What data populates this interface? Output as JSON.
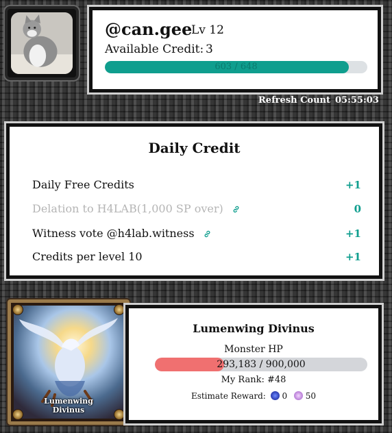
{
  "profile": {
    "username": "@can.gee",
    "level": "Lv 12",
    "credit_label": "Available Credit:",
    "credit_value": "3",
    "progress_text": "603 / 648",
    "progress_value": 603,
    "progress_max": 648
  },
  "refresh": {
    "label": "Refresh Count",
    "time": "05:55:03"
  },
  "daily": {
    "title": "Daily Credit",
    "rows": [
      {
        "label": "Daily Free Credits",
        "value": "+1"
      },
      {
        "label": "Delation to H4LAB(1,000 SP over)",
        "value": "0"
      },
      {
        "label": "Witness vote @h4lab.witness",
        "value": "+1"
      },
      {
        "label": "Credits per level 10",
        "value": "+1"
      }
    ]
  },
  "boss": {
    "card_name_line1": "Lumenwing",
    "card_name_line2": "Divinus",
    "name": "Lumenwing Divinus",
    "hp_label": "Monster HP",
    "hp_text": "293,183 / 900,000",
    "hp_current": 293183,
    "hp_max": 900000,
    "rank": "My Rank: #48",
    "reward_label": "Estimate Reward:",
    "reward_token1": "0",
    "reward_token2": "50"
  },
  "colors": {
    "accent": "#0f9e8e",
    "hp_fill": "#f07070",
    "disabled_text": "#b5b5b5"
  },
  "icons": {
    "link": "link-icon",
    "reward_token1": "blue-token-icon",
    "reward_token2": "crystal-token-icon"
  }
}
